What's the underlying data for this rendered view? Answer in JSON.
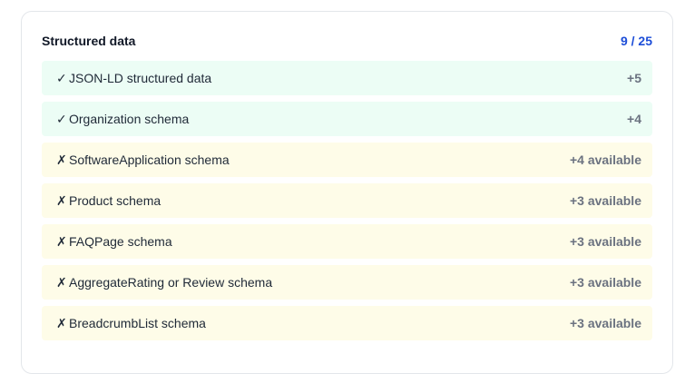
{
  "section": {
    "title": "Structured data",
    "score": "9 / 25"
  },
  "items": [
    {
      "status": "pass",
      "mark": "✓",
      "label": "JSON-LD structured data",
      "points": "+5"
    },
    {
      "status": "pass",
      "mark": "✓",
      "label": "Organization schema",
      "points": "+4"
    },
    {
      "status": "fail",
      "mark": "✗",
      "label": "SoftwareApplication schema",
      "points": "+4 available"
    },
    {
      "status": "fail",
      "mark": "✗",
      "label": "Product schema",
      "points": "+3 available"
    },
    {
      "status": "fail",
      "mark": "✗",
      "label": "FAQPage schema",
      "points": "+3 available"
    },
    {
      "status": "fail",
      "mark": "✗",
      "label": "AggregateRating or Review schema",
      "points": "+3 available"
    },
    {
      "status": "fail",
      "mark": "✗",
      "label": "BreadcrumbList schema",
      "points": "+3 available"
    }
  ],
  "colors": {
    "pass_background": "#ecfdf5",
    "fail_background": "#fefce8",
    "score_accent": "#1d4ed8"
  }
}
